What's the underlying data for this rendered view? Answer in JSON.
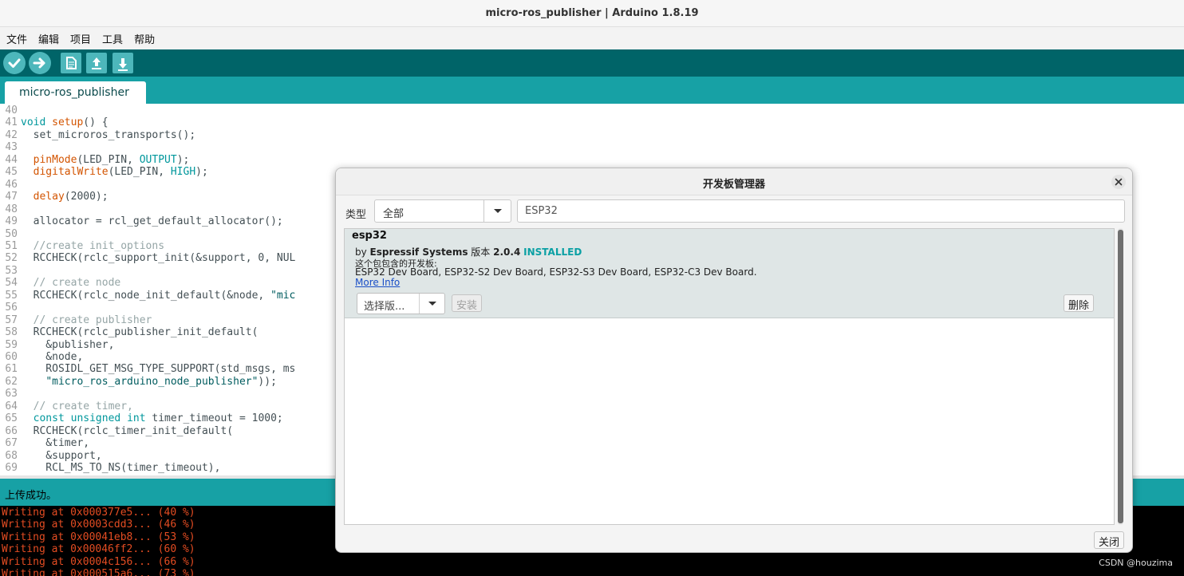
{
  "window": {
    "title": "micro-ros_publisher | Arduino 1.8.19"
  },
  "menubar": {
    "items": [
      "文件",
      "编辑",
      "项目",
      "工具",
      "帮助"
    ]
  },
  "toolbar": {
    "buttons": [
      "verify-icon",
      "upload-icon",
      "new-icon",
      "open-icon",
      "save-icon"
    ]
  },
  "tabs": [
    {
      "label": "micro-ros_publisher"
    }
  ],
  "editor": {
    "lines": [
      {
        "n": "40",
        "text": ""
      },
      {
        "n": "41",
        "text": "void setup() {"
      },
      {
        "n": "42",
        "text": "  set_microros_transports();"
      },
      {
        "n": "43",
        "text": ""
      },
      {
        "n": "44",
        "text": "  pinMode(LED_PIN, OUTPUT);"
      },
      {
        "n": "45",
        "text": "  digitalWrite(LED_PIN, HIGH);"
      },
      {
        "n": "46",
        "text": ""
      },
      {
        "n": "47",
        "text": "  delay(2000);"
      },
      {
        "n": "48",
        "text": ""
      },
      {
        "n": "49",
        "text": "  allocator = rcl_get_default_allocator();"
      },
      {
        "n": "50",
        "text": ""
      },
      {
        "n": "51",
        "text": "  //create init_options"
      },
      {
        "n": "52",
        "text": "  RCCHECK(rclc_support_init(&support, 0, NUL"
      },
      {
        "n": "53",
        "text": ""
      },
      {
        "n": "54",
        "text": "  // create node"
      },
      {
        "n": "55",
        "text": "  RCCHECK(rclc_node_init_default(&node, \"mic"
      },
      {
        "n": "56",
        "text": ""
      },
      {
        "n": "57",
        "text": "  // create publisher"
      },
      {
        "n": "58",
        "text": "  RCCHECK(rclc_publisher_init_default("
      },
      {
        "n": "59",
        "text": "    &publisher,"
      },
      {
        "n": "60",
        "text": "    &node,"
      },
      {
        "n": "61",
        "text": "    ROSIDL_GET_MSG_TYPE_SUPPORT(std_msgs, ms"
      },
      {
        "n": "62",
        "text": "    \"micro_ros_arduino_node_publisher\"));"
      },
      {
        "n": "63",
        "text": ""
      },
      {
        "n": "64",
        "text": "  // create timer,"
      },
      {
        "n": "65",
        "text": "  const unsigned int timer_timeout = 1000;"
      },
      {
        "n": "66",
        "text": "  RCCHECK(rclc_timer_init_default("
      },
      {
        "n": "67",
        "text": "    &timer,"
      },
      {
        "n": "68",
        "text": "    &support,"
      },
      {
        "n": "69",
        "text": "    RCL_MS_TO_NS(timer_timeout),"
      }
    ]
  },
  "status": {
    "message": "上传成功。"
  },
  "console": {
    "lines": [
      "Writing at 0x000377e5... (40 %)",
      "Writing at 0x0003cdd3... (46 %)",
      "Writing at 0x00041eb8... (53 %)",
      "Writing at 0x00046ff2... (60 %)",
      "Writing at 0x0004c156... (66 %)",
      "Writing at 0x000515a6... (73 %)"
    ]
  },
  "watermark": "CSDN @houzima",
  "dialog": {
    "title": "开发板管理器",
    "filter_label": "类型",
    "type_value": "全部",
    "search_value": "ESP32",
    "entry": {
      "name": "esp32",
      "by": "by",
      "author": "Espressif Systems",
      "version_label": "版本",
      "version": "2.0.4",
      "installed": "INSTALLED",
      "desc": "这个包包含的开发板:",
      "boards": "ESP32 Dev Board, ESP32-S2 Dev Board, ESP32-S3 Dev Board, ESP32-C3 Dev Board.",
      "more_info": "More Info",
      "version_select": "选择版...",
      "install_label": "安装",
      "remove_label": "删除"
    },
    "close_label": "关闭"
  },
  "colors": {
    "toolbar": "#006468",
    "tabstrip": "#17a1a5",
    "keyword": "#00979c",
    "function": "#d35400",
    "console_text": "#e34c22",
    "installed": "#0aa0a4"
  }
}
